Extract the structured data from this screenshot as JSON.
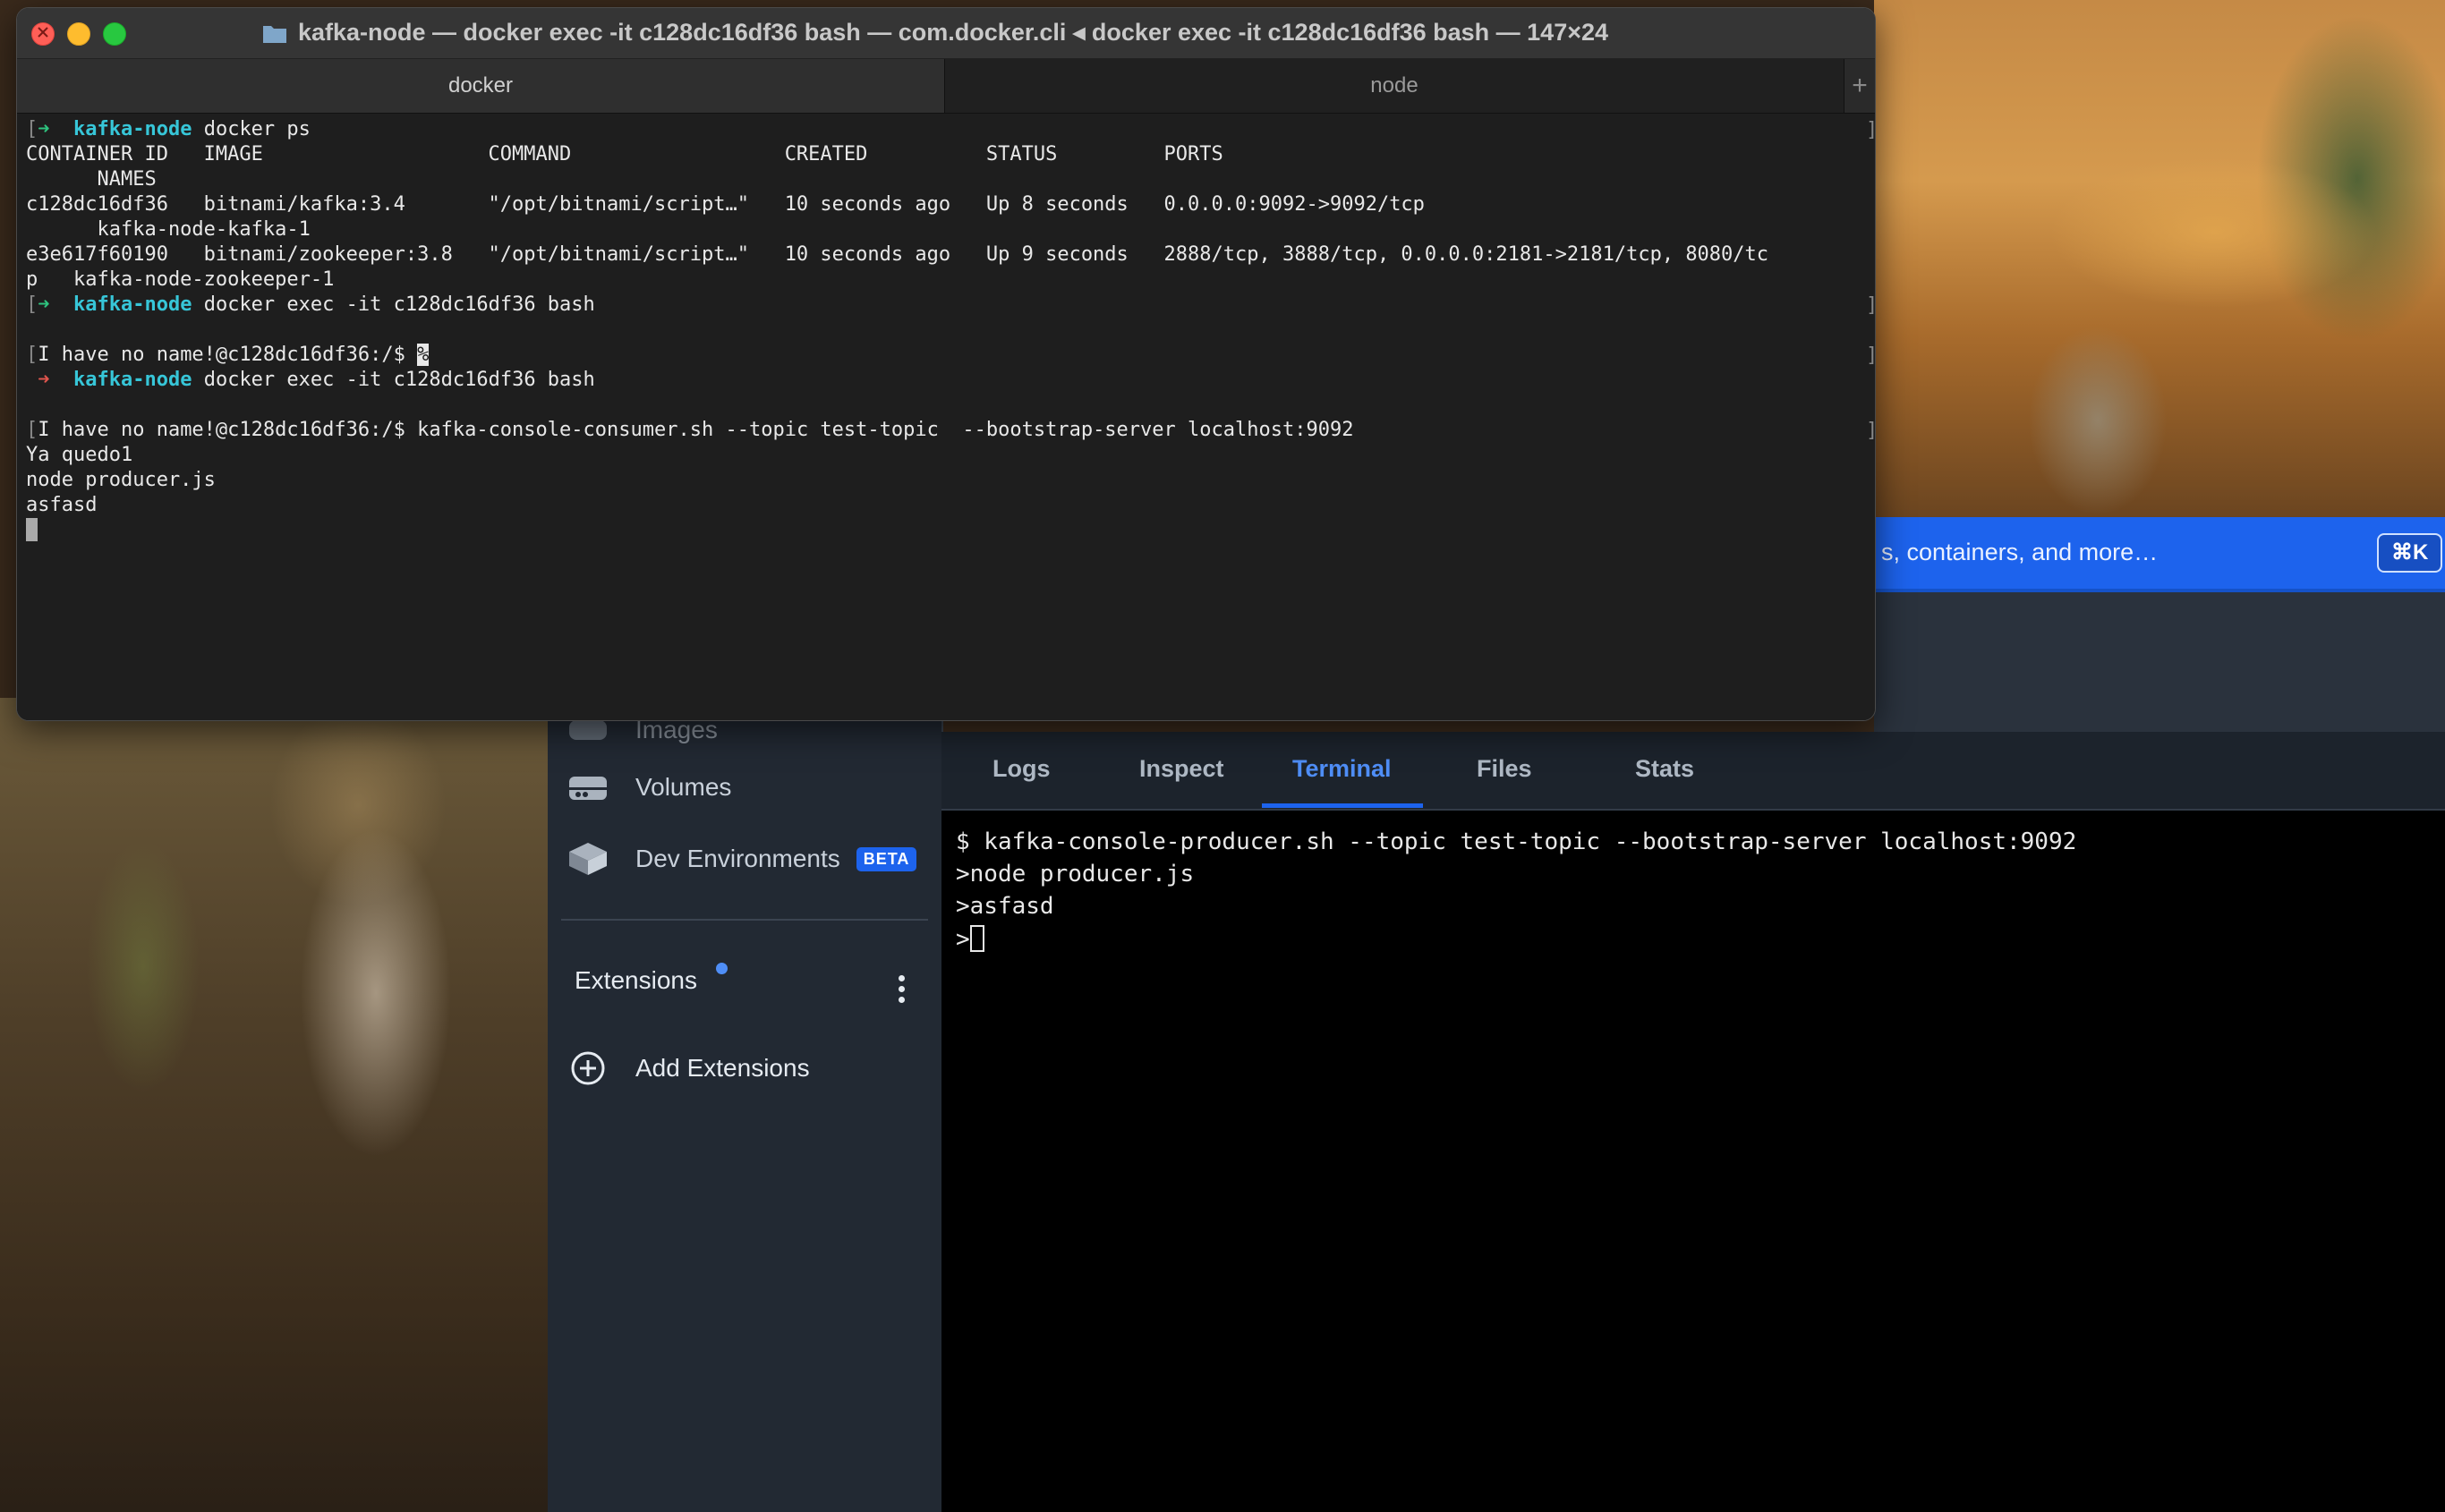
{
  "terminal_window": {
    "title": "kafka-node — docker exec -it c128dc16df36 bash — com.docker.cli ◂ docker exec -it c128dc16df36 bash — 147×24",
    "tabs": [
      {
        "label": "docker",
        "active": true
      },
      {
        "label": "node",
        "active": false
      }
    ],
    "new_tab_symbol": "+",
    "prompt_dir": "kafka-node",
    "lines": {
      "l1_cmd": "docker ps",
      "l2": "CONTAINER ID   IMAGE                   COMMAND                  CREATED          STATUS         PORTS",
      "l3": "      NAMES",
      "l4": "c128dc16df36   bitnami/kafka:3.4       \"/opt/bitnami/script…\"   10 seconds ago   Up 8 seconds   0.0.0.0:9092->9092/tcp",
      "l5": "      kafka-node-kafka-1",
      "l6": "e3e617f60190   bitnami/zookeeper:3.8   \"/opt/bitnami/script…\"   10 seconds ago   Up 9 seconds   2888/tcp, 3888/tcp, 0.0.0.0:2181->2181/tcp, 8080/tc",
      "l7": "p   kafka-node-zookeeper-1",
      "l8_cmd": "docker exec -it c128dc16df36 bash",
      "l10_prompt": "I have no name!@c128dc16df36:/$ ",
      "l10_cursor": "%",
      "l11_cmd": "docker exec -it c128dc16df36 bash",
      "l13_prompt": "I have no name!@c128dc16df36:/$ ",
      "l13_cmd": "kafka-console-consumer.sh --topic test-topic  --bootstrap-server localhost:9092",
      "l14": "Ya quedo1",
      "l15": "node producer.js",
      "l16": "asfasd"
    },
    "prompt_arrow": "➜",
    "left_bracket": "[",
    "right_bracket": "]"
  },
  "docker_desktop": {
    "search_placeholder_visible": "s, containers, and more…",
    "search_shortcut": "⌘K",
    "sidebar": {
      "items": [
        {
          "label": "Images",
          "icon": "images-icon"
        },
        {
          "label": "Volumes",
          "icon": "volumes-icon"
        },
        {
          "label": "Dev Environments",
          "icon": "dev-environments-icon",
          "badge": "BETA"
        }
      ],
      "extensions_label": "Extensions",
      "add_extensions_label": "Add Extensions"
    },
    "tabs": [
      {
        "label": "Logs",
        "active": false
      },
      {
        "label": "Inspect",
        "active": false
      },
      {
        "label": "Terminal",
        "active": true
      },
      {
        "label": "Files",
        "active": false
      },
      {
        "label": "Stats",
        "active": false
      }
    ],
    "terminal_lines": {
      "t1": "$ kafka-console-producer.sh --topic test-topic --bootstrap-server localhost:9092",
      "t2": ">node producer.js",
      "t3": ">asfasd",
      "t4": ">"
    },
    "accent_color": "#1d63ed"
  }
}
